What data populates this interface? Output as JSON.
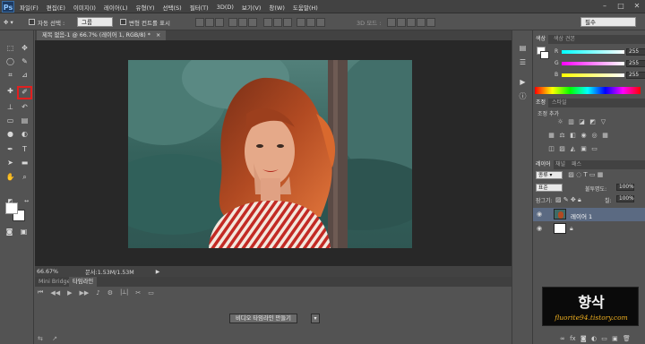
{
  "menubar": {
    "logo": "Ps",
    "items": [
      "파일(F)",
      "편집(E)",
      "이미지(I)",
      "레이어(L)",
      "유형(Y)",
      "선택(S)",
      "필터(T)",
      "3D(D)",
      "보기(V)",
      "창(W)",
      "도움말(H)"
    ]
  },
  "options": {
    "auto_select_label": "자동 선택 :",
    "auto_select_value": "그룹",
    "transform_label": "변형 컨트롤 표시",
    "mode_3d": "3D 모드 :",
    "workspace": "필수"
  },
  "document": {
    "tab_title": "제목 없음-1 @ 66.7% (레이어 1, RGB/8) *",
    "zoom": "66.67%",
    "doc_info": "문서:1.53M/1.53M"
  },
  "timeline": {
    "tab_bridge": "Mini Bridge",
    "tab_timeline": "타임라인",
    "create_button": "비디오 타임라인 만들기"
  },
  "color_panel": {
    "tab_color": "색상",
    "tab_swatches": "색상 견본",
    "r_label": "R",
    "g_label": "G",
    "b_label": "B",
    "r_value": "255",
    "g_value": "255",
    "b_value": "255"
  },
  "adjust_panel": {
    "tab_adjust": "조정",
    "tab_styles": "스타일",
    "add_label": "조정 추가"
  },
  "layers_panel": {
    "tab_layers": "레이어",
    "tab_channels": "채널",
    "tab_paths": "패스",
    "filter_label": "종류",
    "blend_mode": "표준",
    "opacity_label": "불투명도:",
    "opacity_value": "100%",
    "lock_label": "잠그기:",
    "fill_label": "칠:",
    "fill_value": "100%",
    "layer1_name": "레이어 1"
  },
  "watermark": {
    "title": "향삭",
    "url": "fluorite94.tistory.com"
  },
  "colors": {
    "accent_highlight": "#e02020",
    "canvas_bg": "#282828",
    "panel_bg": "#535353",
    "selected_layer": "#5b6a82"
  }
}
